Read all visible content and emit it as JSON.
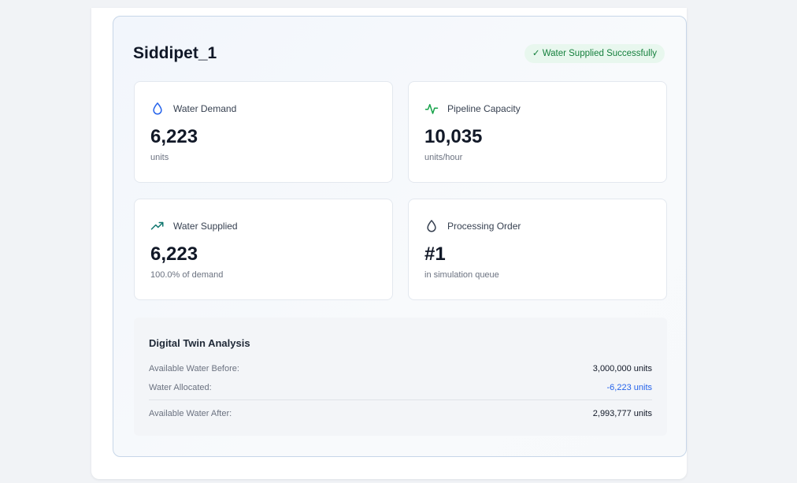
{
  "card": {
    "title": "Siddipet_1",
    "status": "✓ Water Supplied Successfully"
  },
  "metrics": [
    {
      "label": "Water Demand",
      "value": "6,223",
      "unit": "units",
      "icon": "droplet-icon"
    },
    {
      "label": "Pipeline Capacity",
      "value": "10,035",
      "unit": "units/hour",
      "icon": "activity-icon"
    },
    {
      "label": "Water Supplied",
      "value": "6,223",
      "unit": "100.0% of demand",
      "icon": "trending-up-icon"
    },
    {
      "label": "Processing Order",
      "value": "#1",
      "unit": "in simulation queue",
      "icon": "droplet-outline-icon"
    }
  ],
  "analysis": {
    "title": "Digital Twin Analysis",
    "rows": [
      {
        "label": "Available Water Before:",
        "value": "3,000,000 units"
      },
      {
        "label": "Water Allocated:",
        "value": "-6,223 units"
      },
      {
        "label": "Available Water After:",
        "value": "2,993,777 units"
      }
    ]
  },
  "colors": {
    "status_green": "#15803d",
    "status_bg": "#e8f7ee",
    "droplet_blue": "#2563eb",
    "activity_green": "#16a34a",
    "trend_teal": "#0f766e",
    "negative_blue": "#2563eb"
  }
}
